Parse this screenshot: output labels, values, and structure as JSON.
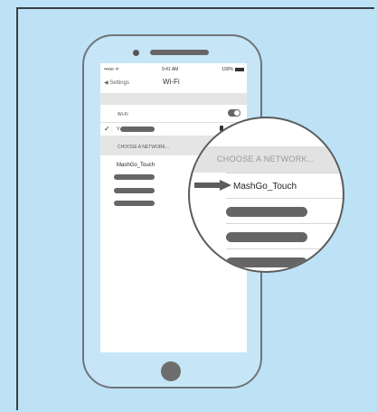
{
  "status_bar": {
    "carrier": "•••oo ᯤ",
    "time": "9:41 AM",
    "battery": "100%"
  },
  "nav": {
    "back_label": "Settings",
    "title": "Wi-Fi"
  },
  "wifi": {
    "label": "Wi-Fi",
    "enabled": true,
    "connected_prefix": "V"
  },
  "networks": {
    "section_label": "CHOOSE A NETWORK...",
    "items": [
      "MashGo_Touch"
    ]
  },
  "magnifier": {
    "section_label": "CHOOSE A NETWORK...",
    "network": "MashGo_Touch"
  },
  "colors": {
    "background": "#bde2f6",
    "bar": "#666666",
    "arrow": "#5c5c5c"
  },
  "icons": [
    "back-chevron-icon",
    "checkmark-icon",
    "lock-icon",
    "toggle-switch",
    "arrow-right-icon"
  ]
}
